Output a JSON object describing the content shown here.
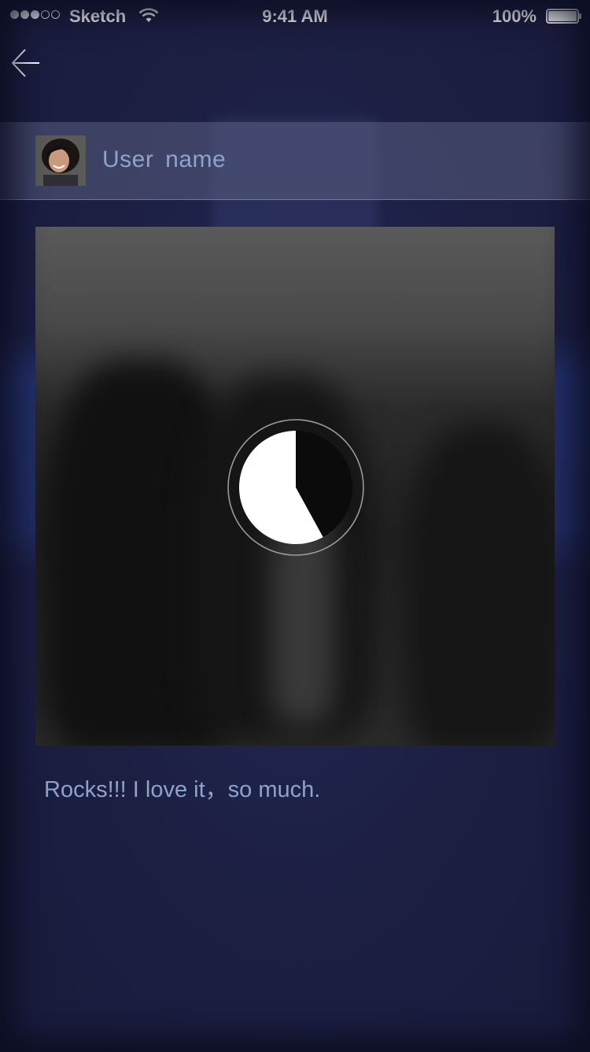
{
  "status_bar": {
    "carrier": "Sketch",
    "time": "9:41 AM",
    "battery_percent": "100%",
    "signal_bars_filled": 3,
    "signal_bars_total": 5,
    "battery_level": 1.0
  },
  "header": {
    "back_icon": "arrow-left-icon"
  },
  "user": {
    "name": "User  name",
    "avatar_icon": "user-avatar"
  },
  "media": {
    "loading_progress": 0.42,
    "loading_icon": "pie-progress-icon"
  },
  "post": {
    "caption": "Rocks!!! I love it，so much."
  },
  "colors": {
    "background": "#1b1e3f",
    "accent_text": "#8ea3cc",
    "user_bar": "#4a4e70"
  }
}
